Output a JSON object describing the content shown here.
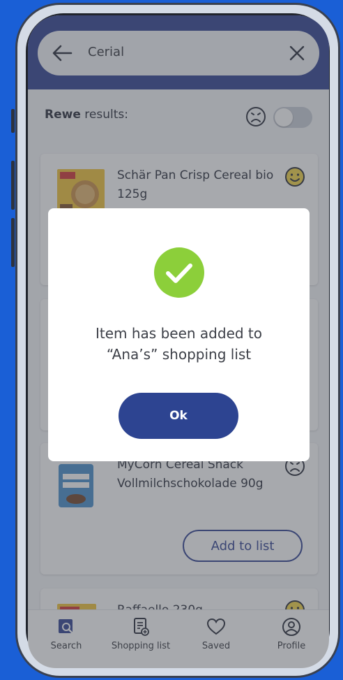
{
  "search": {
    "query": "Cerial"
  },
  "results": {
    "store": "Rewe",
    "label": "results:"
  },
  "products": [
    {
      "name": "Schär Pan Crisp Cereal bio 125g",
      "rating": "happy"
    },
    {
      "name": "",
      "rating": ""
    },
    {
      "name": "MyCorn Cereal Snack Vollmilchschokolade 90g",
      "rating": "unhappy",
      "add_label": "Add to list"
    },
    {
      "name": "Raffaello 230g",
      "rating": "happy"
    }
  ],
  "nav": {
    "items": [
      {
        "label": "Search",
        "icon": "search-icon"
      },
      {
        "label": "Shopping list",
        "icon": "shopping-list-icon"
      },
      {
        "label": "Saved",
        "icon": "heart-icon"
      },
      {
        "label": "Profile",
        "icon": "profile-icon"
      }
    ]
  },
  "dialog": {
    "message_line1": "Item has been added to",
    "message_line2": "“Ana’s” shopping list",
    "ok_label": "Ok"
  },
  "colors": {
    "primary": "#27398c",
    "success": "#8ccf3a",
    "happy_face": "#f2d33d",
    "background": "#1a5fd6"
  }
}
